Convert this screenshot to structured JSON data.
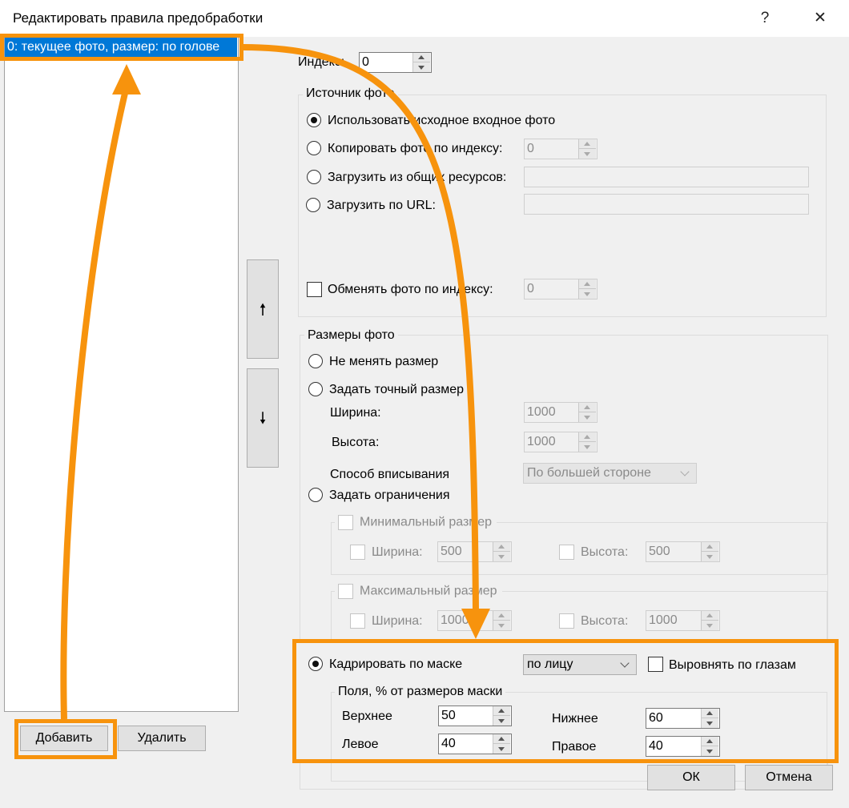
{
  "window": {
    "title": "Редактировать правила предобработки",
    "help_glyph": "?",
    "close_glyph": "✕"
  },
  "rules_list": {
    "items": [
      "0: текущее фото, размер: по голове"
    ]
  },
  "move_buttons": {
    "up_glyph": "🠕",
    "down_glyph": "🠗"
  },
  "index": {
    "label": "Индекс:",
    "value": "0"
  },
  "source_group": {
    "title": "Источник фото",
    "use_original": "Использовать исходное входное фото",
    "copy_by_index": "Копировать фото по индексу:",
    "copy_by_index_value": "0",
    "load_shared": "Загрузить из общих ресурсов:",
    "load_url": "Загрузить по URL:",
    "swap_by_index": "Обменять фото по индексу:",
    "swap_by_index_value": "0"
  },
  "size_group": {
    "title": "Размеры фото",
    "no_resize": "Не менять размер",
    "exact_size": "Задать точный размер",
    "width_label": "Ширина:",
    "width_value": "1000",
    "height_label": "Высота:",
    "height_value": "1000",
    "fit_label": "Способ вписывания",
    "fit_value": "По большей стороне",
    "limits": "Задать ограничения",
    "min_size": {
      "title": "Минимальный размер",
      "width_label": "Ширина:",
      "width_value": "500",
      "height_label": "Высота:",
      "height_value": "500"
    },
    "max_size": {
      "title": "Максимальный размер",
      "width_label": "Ширина:",
      "width_value": "1000",
      "height_label": "Высота:",
      "height_value": "1000"
    },
    "crop_mask": "Кадрировать по маске",
    "crop_mask_value": "по лицу",
    "align_eyes": "Выровнять по глазам",
    "margins": {
      "title": "Поля, % от размеров маски",
      "top_label": "Верхнее",
      "top_value": "50",
      "bottom_label": "Нижнее",
      "bottom_value": "60",
      "left_label": "Левое",
      "left_value": "40",
      "right_label": "Правое",
      "right_value": "40"
    }
  },
  "buttons": {
    "add": "Добавить",
    "delete": "Удалить",
    "ok": "ОК",
    "cancel": "Отмена"
  },
  "colors": {
    "highlight": "#f7930d",
    "selection": "#0078d7"
  }
}
